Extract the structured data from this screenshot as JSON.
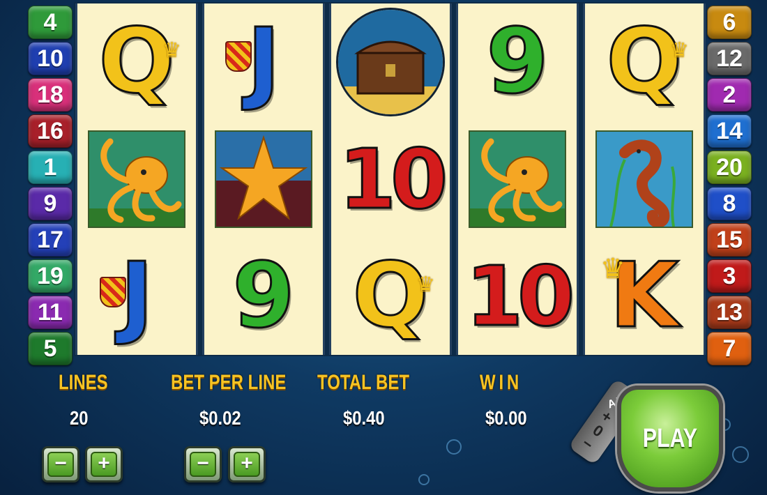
{
  "paylines_left": [
    {
      "n": "4",
      "color": "#2f9a3a"
    },
    {
      "n": "10",
      "color": "#1f3fb0"
    },
    {
      "n": "18",
      "color": "#d8307a"
    },
    {
      "n": "16",
      "color": "#a8202a"
    },
    {
      "n": "1",
      "color": "#27b0b4"
    },
    {
      "n": "9",
      "color": "#5a2aa8"
    },
    {
      "n": "17",
      "color": "#2440b8"
    },
    {
      "n": "19",
      "color": "#33a866"
    },
    {
      "n": "11",
      "color": "#8a2ab0"
    },
    {
      "n": "5",
      "color": "#1e7a2c"
    }
  ],
  "paylines_right": [
    {
      "n": "6",
      "color": "#c88a10"
    },
    {
      "n": "12",
      "color": "#6a6a6a"
    },
    {
      "n": "2",
      "color": "#a02ab0"
    },
    {
      "n": "14",
      "color": "#1f6fd0"
    },
    {
      "n": "20",
      "color": "#7ab020"
    },
    {
      "n": "8",
      "color": "#1f4fc8"
    },
    {
      "n": "15",
      "color": "#c0401a"
    },
    {
      "n": "3",
      "color": "#c01a1a"
    },
    {
      "n": "13",
      "color": "#a83a1a"
    },
    {
      "n": "7",
      "color": "#e06010"
    }
  ],
  "reels": [
    [
      "Q",
      "octopus",
      "J"
    ],
    [
      "J",
      "starfish",
      "9"
    ],
    [
      "treasure-chest",
      "10",
      "Q"
    ],
    [
      "9",
      "octopus",
      "10"
    ],
    [
      "Q",
      "seahorse",
      "K"
    ]
  ],
  "info": {
    "lines_label": "LINES",
    "lines_value": "20",
    "bet_per_line_label": "BET PER LINE",
    "bet_per_line_value": "$0.02",
    "total_bet_label": "TOTAL BET",
    "total_bet_value": "$0.40",
    "win_label": "WIN",
    "win_value": "$0.00"
  },
  "buttons": {
    "minus": "−",
    "plus": "+",
    "play": "PLAY",
    "auto": "AUTO",
    "auto_plus": "+",
    "auto_zero": "0",
    "auto_minus": "−"
  },
  "colors": {
    "label_gold": "#f6c323",
    "reel_bg": "#fbf3c9"
  }
}
